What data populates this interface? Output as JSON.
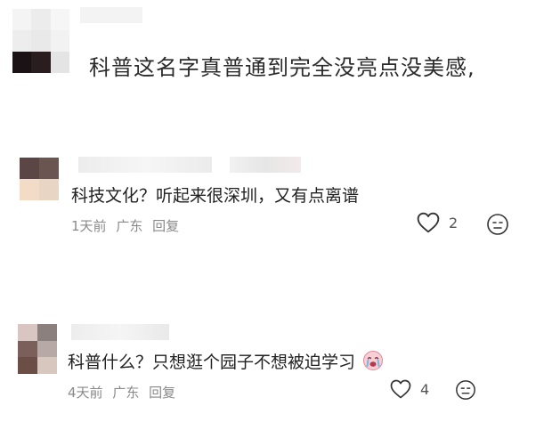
{
  "top_comment": {
    "text": "科普这名字真普通到完全没亮点没美感,"
  },
  "comments": [
    {
      "text": "科技文化？听起来很深圳，又有点离谱",
      "time": "1天前",
      "location": "广东",
      "reply_label": "回复",
      "likes": "2"
    },
    {
      "text": "科普什么？只想逛个园子不想被迫学习",
      "time": "4天前",
      "location": "广东",
      "reply_label": "回复",
      "likes": "4"
    }
  ],
  "icons": {
    "like": "heart-outline-icon",
    "dislike": "neutral-face-icon",
    "cry_emoji": "crying-face-emoji"
  },
  "colors": {
    "meta_text": "#8a8a8a",
    "body_text": "#222222",
    "background": "#ffffff"
  }
}
